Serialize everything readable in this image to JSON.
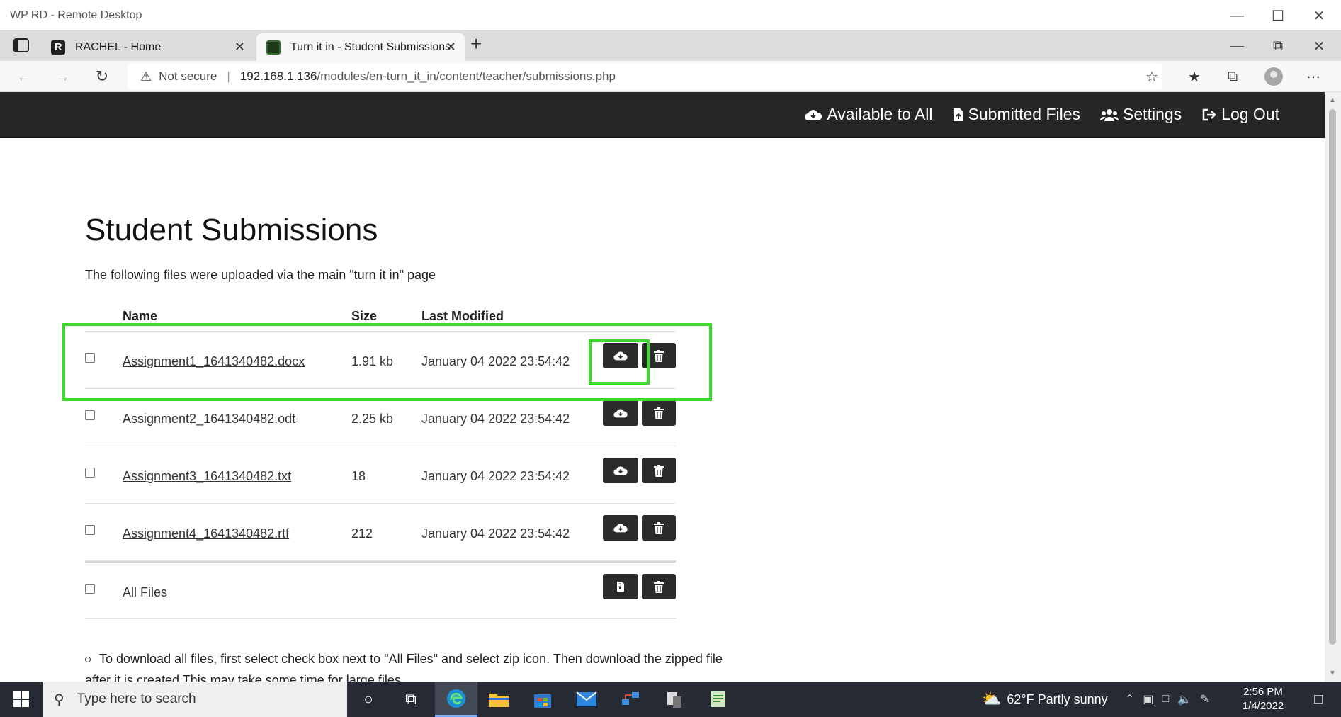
{
  "remote_window": {
    "title": "WP RD - Remote Desktop"
  },
  "browser": {
    "tabs": [
      {
        "label": "RACHEL - Home",
        "favicon": "R",
        "active": false
      },
      {
        "label": "Turn it in - Student Submissions",
        "active": true
      }
    ],
    "zoom_icon": "⚲",
    "more_icon": "⋯",
    "address": {
      "security_text": "Not secure",
      "host": "192.168.1.136",
      "path": "/modules/en-turn_it_in/content/teacher/submissions.php"
    }
  },
  "page": {
    "nav": [
      {
        "label": "Available to All",
        "icon": "cloud-download-icon"
      },
      {
        "label": "Submitted Files",
        "icon": "file-upload-icon"
      },
      {
        "label": "Settings",
        "icon": "users-icon"
      },
      {
        "label": "Log Out",
        "icon": "sign-out-icon"
      }
    ],
    "title": "Student Submissions",
    "intro": "The following files were uploaded via the main \"turn it in\" page",
    "columns": {
      "name": "Name",
      "size": "Size",
      "modified": "Last Modified"
    },
    "files": [
      {
        "name": "Assignment1_1641340482.docx",
        "size": "1.91 kb",
        "modified": "January 04 2022 23:54:42"
      },
      {
        "name": "Assignment2_1641340482.odt",
        "size": "2.25 kb",
        "modified": "January 04 2022 23:54:42"
      },
      {
        "name": "Assignment3_1641340482.txt",
        "size": "18",
        "modified": "January 04 2022 23:54:42"
      },
      {
        "name": "Assignment4_1641340482.rtf",
        "size": "212",
        "modified": "January 04 2022 23:54:42"
      }
    ],
    "all_files_label": "All Files",
    "note_line1": "To download all files, first select check box next to \"All Files\" and select zip icon. Then download the zipped file",
    "note_line2": "after it is created This may take some time for large files."
  },
  "taskbar": {
    "search_placeholder": "Type here to search",
    "weather": "62°F  Partly sunny",
    "time": "2:56 PM",
    "date": "1/4/2022"
  },
  "colors": {
    "highlight": "#3adb2a",
    "nav_bg": "#262626",
    "button_bg": "#2b2b2b"
  }
}
